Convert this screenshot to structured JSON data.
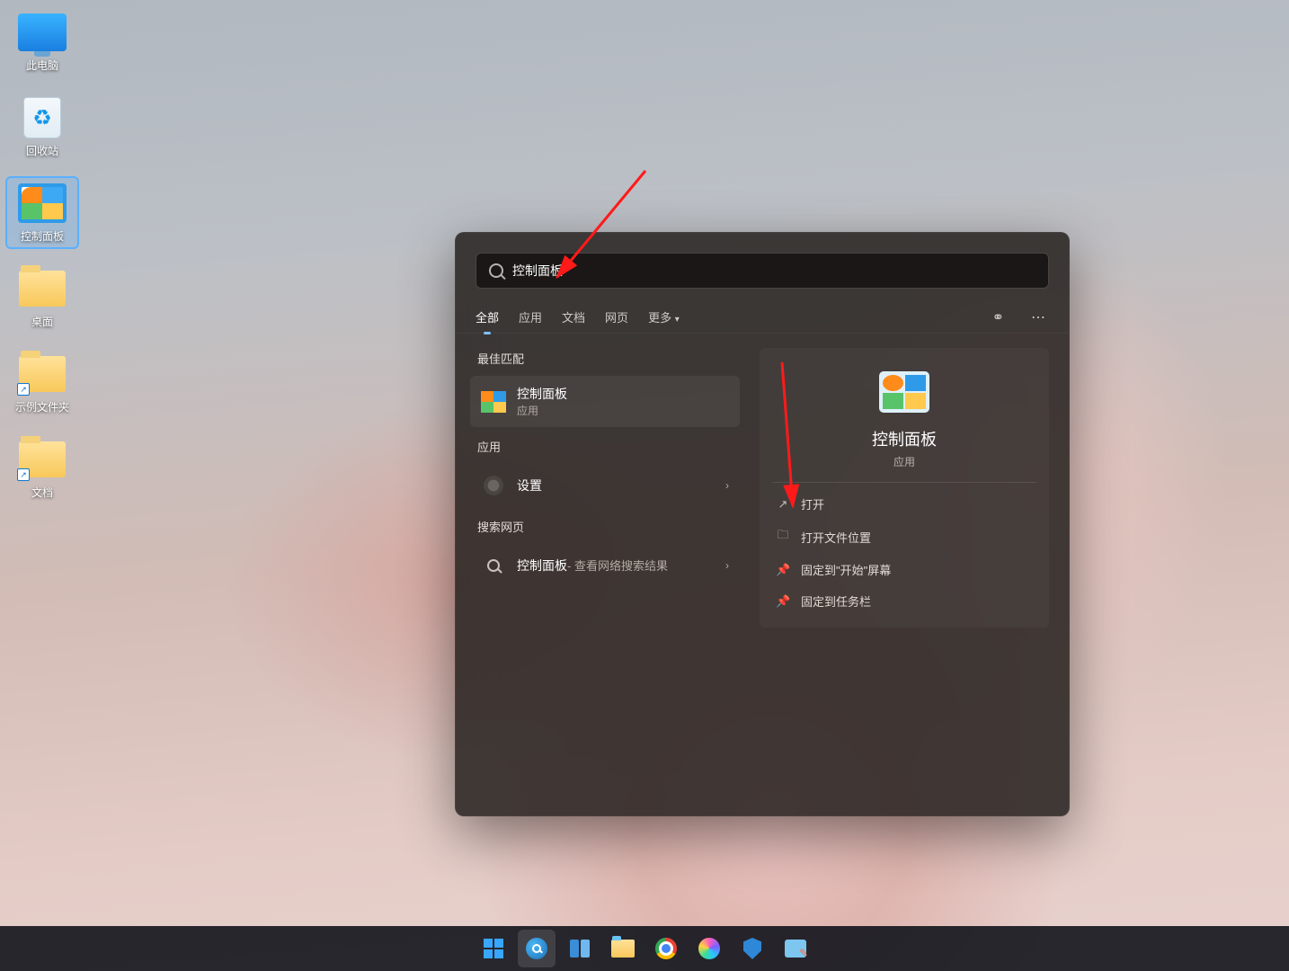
{
  "desktop_icons": [
    {
      "id": "this-pc",
      "label": "此电脑"
    },
    {
      "id": "recycle-bin",
      "label": "回收站"
    },
    {
      "id": "control-panel",
      "label": "控制面板"
    },
    {
      "id": "folder-desktop",
      "label": "桌面"
    },
    {
      "id": "folder-demo",
      "label": "示例文件夹"
    },
    {
      "id": "folder-docs",
      "label": "文档"
    }
  ],
  "search": {
    "query": "控制面板",
    "tabs": {
      "all": "全部",
      "apps": "应用",
      "docs": "文档",
      "web": "网页",
      "more": "更多"
    },
    "sections": {
      "best": "最佳匹配",
      "apps": "应用",
      "web": "搜索网页"
    },
    "best_match": {
      "title": "控制面板",
      "subtitle": "应用"
    },
    "app_result": {
      "title": "设置"
    },
    "web_result": {
      "title": "控制面板",
      "suffix": " - 查看网络搜索结果"
    },
    "preview": {
      "title": "控制面板",
      "subtitle": "应用"
    },
    "actions": {
      "open": "打开",
      "open_location": "打开文件位置",
      "pin_start": "固定到\"开始\"屏幕",
      "pin_taskbar": "固定到任务栏"
    }
  },
  "taskbar": {
    "items": [
      "start",
      "search",
      "taskview",
      "explorer",
      "chrome",
      "copilot",
      "security",
      "snip"
    ]
  }
}
